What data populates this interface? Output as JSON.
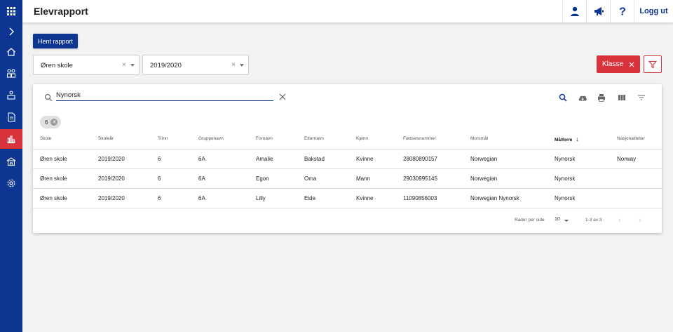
{
  "header": {
    "title": "Elevrapport",
    "logout_label": "Logg ut",
    "icons": [
      "user-icon",
      "megaphone-icon",
      "help-icon"
    ]
  },
  "sidebar": {
    "items": [
      "apps-icon",
      "expand-icon",
      "home-icon",
      "groups-icon",
      "student-icon",
      "report-icon",
      "chart-icon",
      "school-icon",
      "settings-icon"
    ],
    "active_index": 6,
    "bg_color": "#0d3592",
    "active_color": "#d8323d"
  },
  "controls": {
    "fetch_report_label": "Hent rapport",
    "school_select": "Øren skole",
    "year_select": "2019/2020",
    "class_button_label": "Klasse",
    "clear_glyph": "×"
  },
  "search": {
    "value": "Nynorsk",
    "chip_label": "6"
  },
  "table": {
    "columns": [
      "Skole",
      "Skoleår",
      "Trinn",
      "Gruppenavn",
      "Fornavn",
      "Etternavn",
      "Kjønn",
      "Fødselsnummer",
      "Morsmål",
      "Målform",
      "Nasjonaliteter"
    ],
    "sorted_column": "Målform",
    "rows": [
      [
        "Øren skole",
        "2019/2020",
        "6",
        "6A",
        "Amalie",
        "Bakstad",
        "Kvinne",
        "28080890157",
        "Norwegian",
        "Nynorsk",
        "Norway"
      ],
      [
        "Øren skole",
        "2019/2020",
        "6",
        "6A",
        "Egon",
        "Oma",
        "Mann",
        "29030995145",
        "Norwegian",
        "Nynorsk",
        ""
      ],
      [
        "Øren skole",
        "2019/2020",
        "6",
        "6A",
        "Lilly",
        "Eide",
        "Kvinne",
        "11090856003",
        "Norwegian Nynorsk",
        "Nynorsk",
        ""
      ]
    ]
  },
  "pagination": {
    "rows_per_page_label": "Rader per side",
    "rows_per_page": "10",
    "range": "1-3 av 3"
  },
  "colors": {
    "primary": "#0d3592",
    "danger": "#d8323d"
  }
}
